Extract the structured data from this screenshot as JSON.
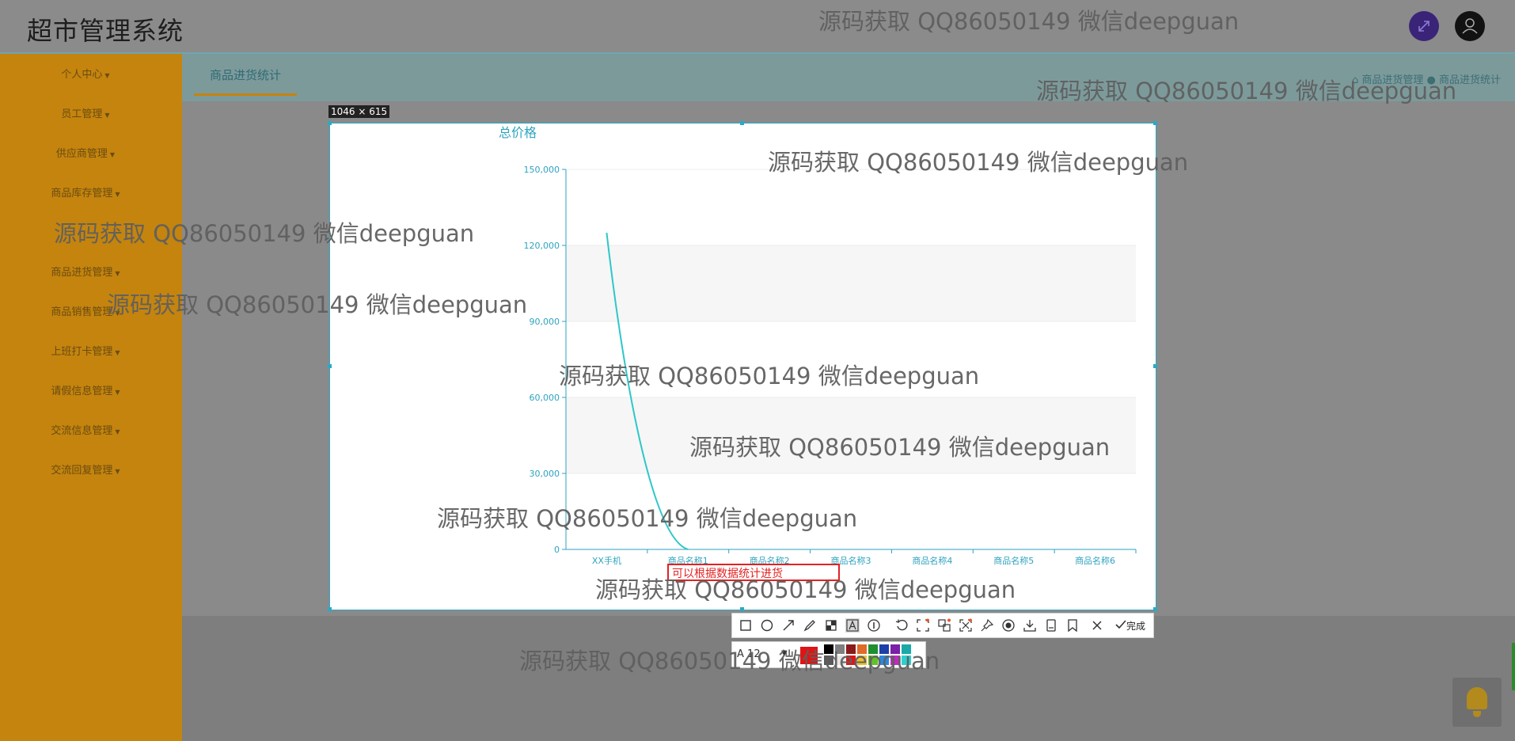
{
  "header": {
    "title": "超市管理系统"
  },
  "sidebar": {
    "items": [
      {
        "label": "个人中心"
      },
      {
        "label": "员工管理"
      },
      {
        "label": "供应商管理"
      },
      {
        "label": "商品库存管理"
      },
      {
        "label": "商品进货管理"
      },
      {
        "label": "商品销售管理"
      },
      {
        "label": "上班打卡管理"
      },
      {
        "label": "请假信息管理"
      },
      {
        "label": "交流信息管理"
      },
      {
        "label": "交流回复管理"
      }
    ]
  },
  "tabs": {
    "active": "商品进货统计"
  },
  "breadcrumb": {
    "text": "⌂ 商品进货管理 ● 商品进货统计"
  },
  "capture": {
    "size_label": "1046 × 615"
  },
  "chart_data": {
    "type": "line",
    "title": "总价格",
    "categories": [
      "XX手机",
      "商品名称1",
      "商品名称2",
      "商品名称3",
      "商品名称4",
      "商品名称5",
      "商品名称6"
    ],
    "series": [
      {
        "values": [
          125000,
          0,
          null,
          null,
          null,
          null,
          null
        ]
      }
    ],
    "ylim": [
      0,
      150000
    ],
    "yticks": [
      "0",
      "30,000",
      "60,000",
      "90,000",
      "120,000",
      "150,000"
    ],
    "grid": "striped horizontal bands",
    "color": "#2ec7c9"
  },
  "annotation": {
    "text": "可以根据数据统计进货"
  },
  "toolbar": {
    "done_label": "完成",
    "icons": [
      "rectangle-icon",
      "circle-icon",
      "arrow-icon",
      "pen-icon",
      "mosaic-icon",
      "text-icon",
      "serial-number-icon",
      "undo-icon",
      "scan-icon",
      "ocr-icon",
      "translate-icon",
      "pin-icon",
      "record-icon",
      "download-icon",
      "long-screenshot-icon",
      "bookmark-icon",
      "close-icon",
      "check-icon"
    ],
    "font_size": "12",
    "current_color": "#e01414",
    "swatches": [
      "#000000",
      "#7f7f7f",
      "#8b1a1a",
      "#e06a2a",
      "#1f8f2f",
      "#1d3fa8",
      "#7a1fa8",
      "#1aa8a8",
      "#5a5a5a",
      "#e6e6e6",
      "#e01414",
      "#f0c02a",
      "#62c02a",
      "#2a8ae0",
      "#c02ac0",
      "#2ad0d0"
    ]
  },
  "watermark": {
    "text": "源码获取 QQ86050149 微信deepguan"
  }
}
